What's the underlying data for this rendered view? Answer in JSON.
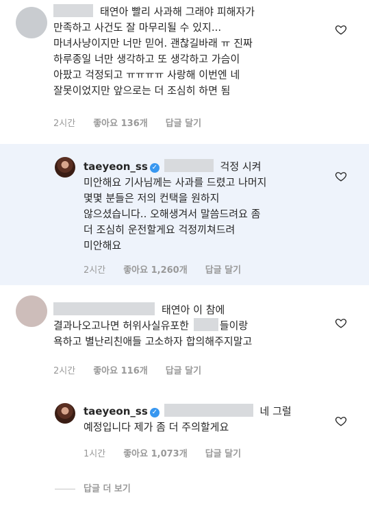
{
  "comments": [
    {
      "lines": [
        "태연아 빨리 사과해 그래야 피해자가",
        "만족하고 사건도 잘 마무리될 수 있지...",
        "마녀사냥이지만 너만 믿어. 괜찮길바래 ㅠ 진짜",
        "하루종일 너만 생각하고 또 생각하고 가슴이",
        "아팠고 걱정되고 ㅠㅠㅠㅠ 사랑해 이번엔 네",
        "잘못이었지만 앞으로는 더 조심히 하면 됨"
      ],
      "time": "2시간",
      "likes": "좋아요 136개",
      "reply": "답글 달기"
    },
    {
      "username": "taeyeon_ss",
      "lines": [
        "걱정 시켜",
        "미안해요 기사님께는 사과를 드렸고 나머지",
        "몇몇 분들은 저의 컨택을 원하지",
        "않으셨습니다.. 오해생겨서 말씀드려요 좀",
        "더 조심히 운전할게요 걱정끼쳐드려",
        "미안해요"
      ],
      "time": "2시간",
      "likes": "좋아요 1,260개",
      "reply": "답글 달기"
    },
    {
      "lines": [
        "태연아 이 참에",
        "결과나오고나면 허위사실유포한",
        "들이랑",
        "욕하고 별난리친애들 고소하자 합의해주지말고"
      ],
      "time": "2시간",
      "likes": "좋아요 116개",
      "reply": "답글 달기"
    },
    {
      "username": "taeyeon_ss",
      "lines": [
        "네 그럴",
        "예정입니다 제가 좀 더 주의할게요"
      ],
      "time": "1시간",
      "likes": "좋아요 1,073개",
      "reply": "답글 달기"
    }
  ],
  "view_more": "답글 더 보기",
  "colors": {
    "reply_highlight": "#eef3fb",
    "verified": "#3897f0",
    "meta": "#999999"
  }
}
